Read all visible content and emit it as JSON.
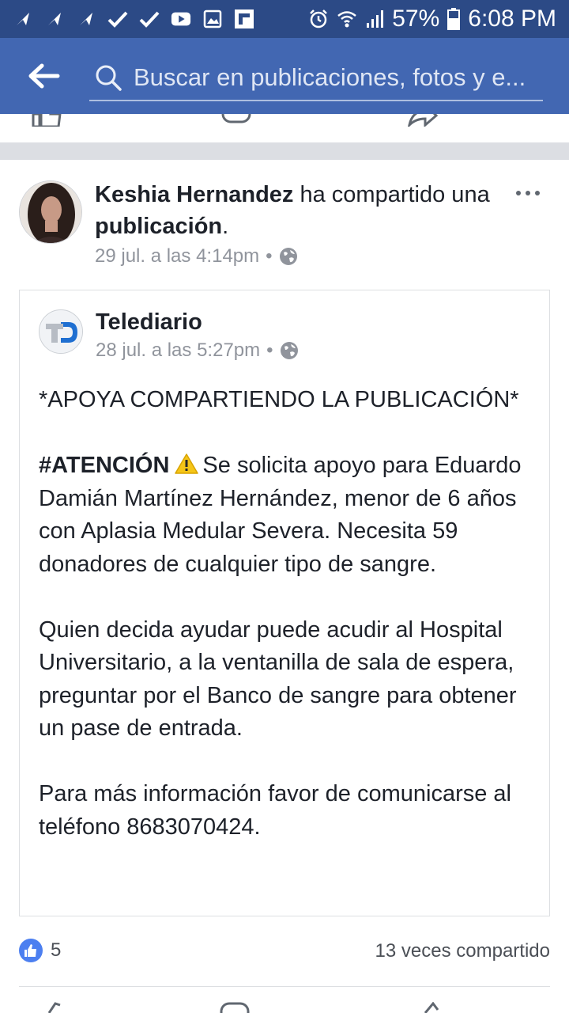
{
  "status_bar": {
    "battery": "57%",
    "time": "6:08 PM"
  },
  "search": {
    "placeholder": "Buscar en publicaciones, fotos y e..."
  },
  "post": {
    "author": "Keshia Hernandez",
    "action_text": "ha compartido una",
    "action_object": "publicación",
    "action_suffix": ".",
    "timestamp": "29 jul. a las 4:14pm",
    "privacy_separator": "•"
  },
  "shared_post": {
    "page_name": "Telediario",
    "logo_text": "TD",
    "timestamp": "28 jul. a las 5:27pm",
    "privacy_separator": "•",
    "paragraph_1": "*APOYA COMPARTIENDO LA PUBLICACIÓN*",
    "hashtag": "#ATENCIÓN",
    "paragraph_2_rest": "Se solicita apoyo para Eduardo Damián Martínez Hernández, menor de 6 años con Aplasia Medular Severa. Necesita 59 donadores de cualquier tipo de sangre.",
    "paragraph_3": "Quien decida ayudar puede acudir al Hospital Universitario, a la ventanilla de sala de espera, preguntar por el Banco de sangre para obtener un pase de entrada.",
    "paragraph_4": "Para más información favor de comunicarse  al teléfono 8683070424."
  },
  "footer": {
    "like_count": "5",
    "share_count": "13 veces compartido"
  },
  "colors": {
    "status_bar": "#2c4a86",
    "header": "#4267b2",
    "like_badge": "#4c7ff0",
    "meta_text": "#90949c"
  }
}
